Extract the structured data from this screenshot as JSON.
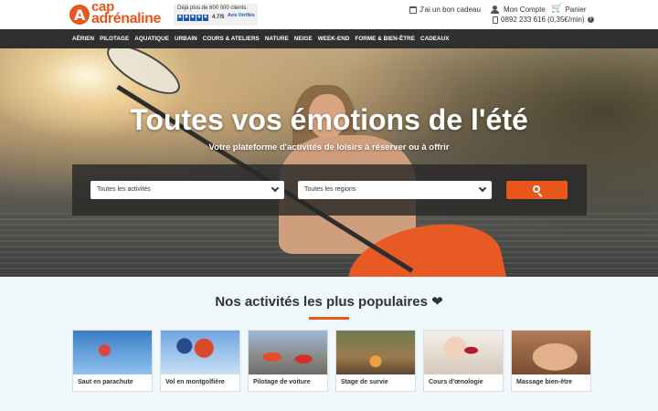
{
  "header": {
    "logo": {
      "line1": "cap",
      "line2": "adrénaline"
    },
    "trust": {
      "text": "Déjà plus de 600 000 clients.",
      "rating": "4.7/5",
      "badge": "Avis Vérifiés"
    },
    "gift_link": "J'ai un bon cadeau",
    "account_link": "Mon Compte",
    "cart_link": "Panier",
    "phone": "0892 233 616 (0,35€/min)"
  },
  "nav": {
    "items": [
      "AÉRIEN",
      "PILOTAGE",
      "AQUATIQUE",
      "URBAIN",
      "COURS & ATELIERS",
      "NATURE",
      "NEIGE",
      "WEEK-END",
      "FORME & BIEN-ÊTRE",
      "CADEAUX"
    ]
  },
  "hero": {
    "title": "Toutes vos émotions de l'été",
    "subtitle": "Votre plateforme d'activités de loisirs à réserver ou à offrir",
    "activity_select": "Toutes les activités",
    "region_select": "Toutes les regions"
  },
  "popular": {
    "title": "Nos activités les plus populaires ❤",
    "cards": [
      {
        "label": "Saut en parachute"
      },
      {
        "label": "Vol en montgolfière"
      },
      {
        "label": "Pilotage de voiture"
      },
      {
        "label": "Stage de survie"
      },
      {
        "label": "Cours d'œnologie"
      },
      {
        "label": "Massage bien-être"
      }
    ]
  },
  "colors": {
    "accent": "#e8561c",
    "nav_bg": "#2f2f2f",
    "section_bg": "#eef8fb"
  }
}
